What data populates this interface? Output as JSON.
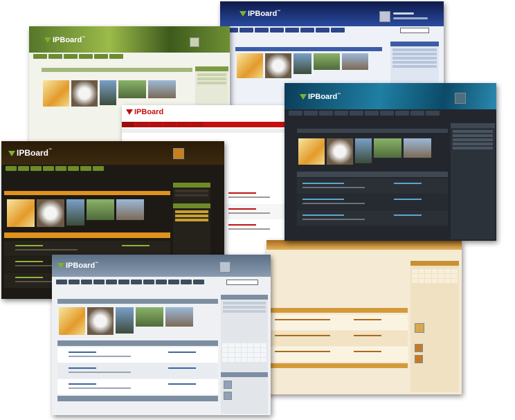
{
  "brand": "IPBoard",
  "trademark": "™",
  "screens": [
    {
      "id": "blue",
      "theme": "blue"
    },
    {
      "id": "green",
      "theme": "green"
    },
    {
      "id": "red",
      "theme": "red"
    },
    {
      "id": "teal",
      "theme": "teal"
    },
    {
      "id": "dark",
      "theme": "dark"
    },
    {
      "id": "cream",
      "theme": "cream"
    },
    {
      "id": "grey",
      "theme": "grey"
    }
  ],
  "colors": {
    "green_accent": "#7ab32e",
    "blue_header": "#1b2c6e",
    "teal_header": "#0f5d7e",
    "dark_header": "#1c1306",
    "red_header": "#c41010",
    "grey_header": "#6f8297",
    "cream_header": "#c89030"
  }
}
